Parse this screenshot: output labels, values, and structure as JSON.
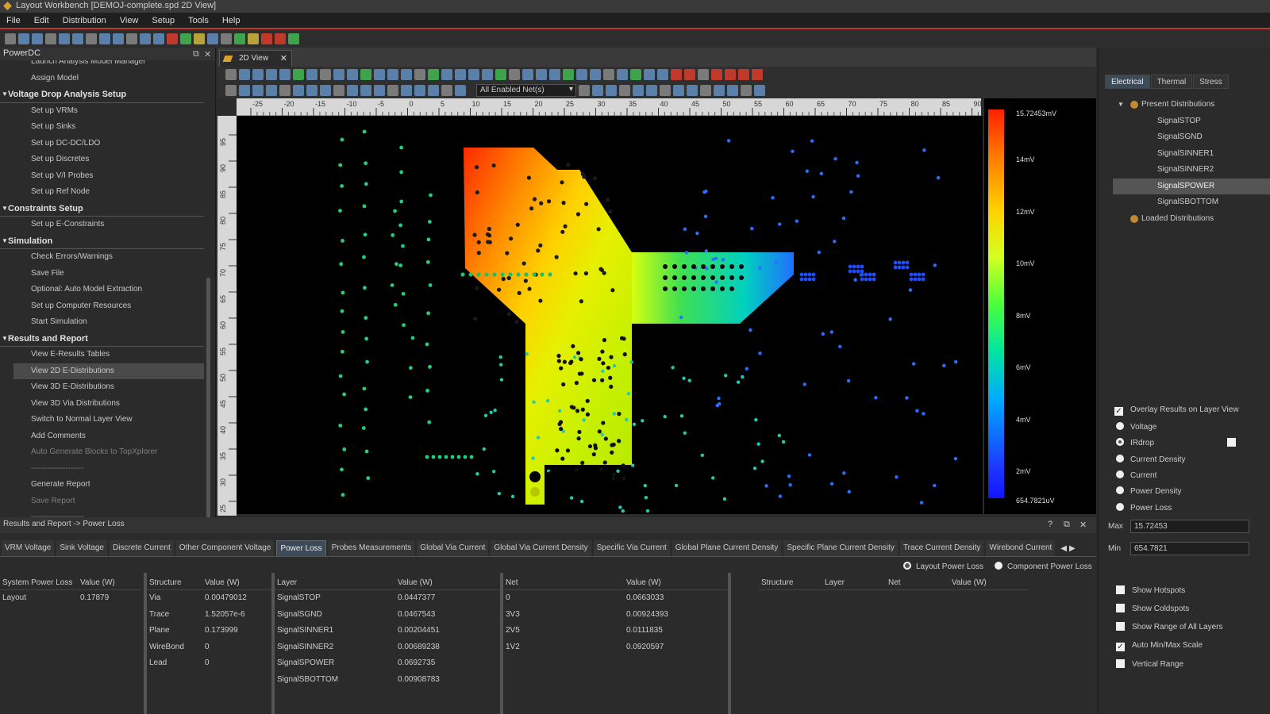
{
  "window": {
    "title": "Layout Workbench [DEMOJ-complete.spd 2D View]"
  },
  "menu": [
    "File",
    "Edit",
    "Distribution",
    "View",
    "Setup",
    "Tools",
    "Help"
  ],
  "left_panel": {
    "title": "PowerDC",
    "items": [
      {
        "type": "item",
        "label": "Launch Analysis Model Manager"
      },
      {
        "type": "item",
        "label": "Assign Model"
      },
      {
        "type": "section",
        "label": "Voltage Drop Analysis Setup"
      },
      {
        "type": "item",
        "label": "Set up VRMs"
      },
      {
        "type": "item",
        "label": "Set up Sinks"
      },
      {
        "type": "item",
        "label": "Set up DC-DC/LDO"
      },
      {
        "type": "item",
        "label": "Set up Discretes"
      },
      {
        "type": "item",
        "label": "Set up V/I Probes"
      },
      {
        "type": "item",
        "label": "Set up Ref Node"
      },
      {
        "type": "section",
        "label": "Constraints Setup"
      },
      {
        "type": "item",
        "label": "Set up E-Constraints"
      },
      {
        "type": "section",
        "label": "Simulation"
      },
      {
        "type": "item",
        "label": "Check Errors/Warnings"
      },
      {
        "type": "item",
        "label": "Save File"
      },
      {
        "type": "item",
        "label": "Optional: Auto Model Extraction"
      },
      {
        "type": "item",
        "label": "Set up Computer Resources"
      },
      {
        "type": "item",
        "label": "Start Simulation"
      },
      {
        "type": "section",
        "label": "Results and Report"
      },
      {
        "type": "item",
        "label": "View E-Results Tables"
      },
      {
        "type": "item",
        "label": "View 2D E-Distributions",
        "selected": true
      },
      {
        "type": "item",
        "label": "View 3D E-Distributions"
      },
      {
        "type": "item",
        "label": "View 3D Via Distributions"
      },
      {
        "type": "item",
        "label": "Switch to Normal Layer View"
      },
      {
        "type": "item",
        "label": "Add Comments"
      },
      {
        "type": "item",
        "label": "Auto Generate Blocks to TopXplorer",
        "dim": true
      },
      {
        "type": "item",
        "label": "--------------------",
        "dim": true
      },
      {
        "type": "item",
        "label": "Generate Report"
      },
      {
        "type": "item",
        "label": "Save Report",
        "dim": true
      },
      {
        "type": "item",
        "label": "--------------------",
        "dim": true
      }
    ]
  },
  "view": {
    "tab_label": "2D View",
    "net_select": "All Enabled Net(s)",
    "ruler_top": [
      "-25",
      "-20",
      "-15",
      "-10",
      "-5",
      "0",
      "5",
      "10",
      "15",
      "20",
      "25",
      "30",
      "35",
      "40",
      "45",
      "50",
      "55",
      "60",
      "65",
      "70",
      "75",
      "80",
      "85",
      "90"
    ],
    "ruler_left": [
      "95",
      "90",
      "85",
      "80",
      "75",
      "70",
      "65",
      "60",
      "55",
      "50",
      "45",
      "40",
      "35",
      "30",
      "25"
    ],
    "legend": {
      "max": "15.72453mV",
      "labels": [
        "14mV",
        "12mV",
        "10mV",
        "8mV",
        "6mV",
        "4mV",
        "2mV"
      ],
      "min": "654.7821uV"
    }
  },
  "right_panel": {
    "tabs": [
      "Electrical",
      "Thermal",
      "Stress"
    ],
    "present_label": "Present Distributions",
    "layers": [
      "SignalSTOP",
      "SignalSGND",
      "SignalSINNER1",
      "SignalSINNER2",
      "SignalSPOWER",
      "SignalSBOTTOM"
    ],
    "selected_layer": "SignalSPOWER",
    "loaded_label": "Loaded Distributions",
    "overlay_label": "Overlay Results on Layer View",
    "modes": [
      "Voltage",
      "IRdrop",
      "Current Density",
      "Current",
      "Power Density",
      "Power Loss"
    ],
    "selected_mode": "IRdrop",
    "max_label": "Max",
    "max_value": "15.72453",
    "min_label": "Min",
    "min_value": "654.7821",
    "checks": [
      {
        "label": "Show Hotspots",
        "checked": false
      },
      {
        "label": "Show Coldspots",
        "checked": false
      },
      {
        "label": "Show Range of All Layers",
        "checked": false
      },
      {
        "label": "Auto Min/Max Scale",
        "checked": true
      },
      {
        "label": "Vertical Range",
        "checked": false
      }
    ]
  },
  "results": {
    "header": "Results and Report -> Power Loss",
    "tabs": [
      "VRM Voltage",
      "Sink Voltage",
      "Discrete Current",
      "Other Component Voltage",
      "Power Loss",
      "Probes Measurements",
      "Global Via Current",
      "Global Via Current Density",
      "Specific Via Current",
      "Global Plane Current Density",
      "Specific Plane Current Density",
      "Trace Current Density",
      "Wirebond Current"
    ],
    "active_tab": "Power Loss",
    "radio_layout": "Layout Power Loss",
    "radio_component": "Component Power Loss",
    "t1": {
      "cols": [
        "System Power Loss",
        "Value (W)"
      ],
      "rows": [
        [
          "Layout",
          "0.17879"
        ]
      ]
    },
    "t2": {
      "cols": [
        "Structure",
        "Value (W)"
      ],
      "rows": [
        [
          "Via",
          "0.00479012"
        ],
        [
          "Trace",
          "1.52057e-6"
        ],
        [
          "Plane",
          "0.173999"
        ],
        [
          "WireBond",
          "0"
        ],
        [
          "Lead",
          "0"
        ]
      ]
    },
    "t3": {
      "cols": [
        "Layer",
        "Value (W)"
      ],
      "rows": [
        [
          "SignalSTOP",
          "0.0447377"
        ],
        [
          "SignalSGND",
          "0.0467543"
        ],
        [
          "SignalSINNER1",
          "0.00204451"
        ],
        [
          "SignalSINNER2",
          "0.00689238"
        ],
        [
          "SignalSPOWER",
          "0.0692735"
        ],
        [
          "SignalSBOTTOM",
          "0.00908783"
        ]
      ]
    },
    "t4": {
      "cols": [
        "Net",
        "Value (W)"
      ],
      "rows": [
        [
          "0",
          "0.0663033"
        ],
        [
          "3V3",
          "0.00924393"
        ],
        [
          "2V5",
          "0.0111835"
        ],
        [
          "1V2",
          "0.0920597"
        ]
      ]
    },
    "t5": {
      "cols": [
        "Structure",
        "Layer",
        "Net",
        "Value (W)"
      ]
    }
  },
  "colors": {
    "accent": "#c0392b",
    "background": "#2b2b2b",
    "canvas": "#000000"
  }
}
